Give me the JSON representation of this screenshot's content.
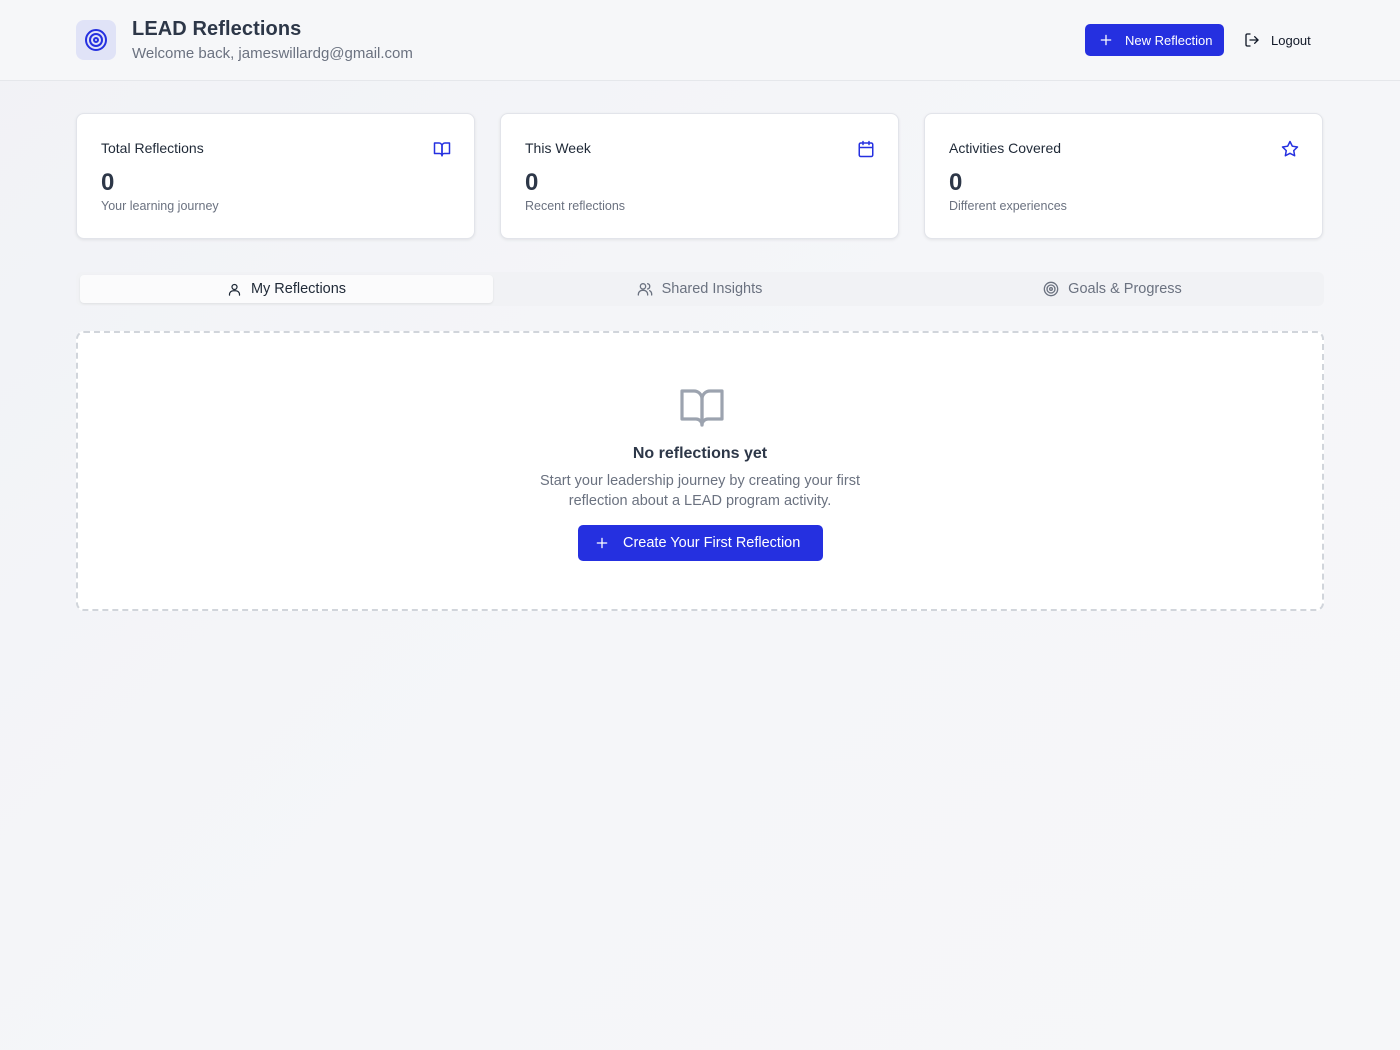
{
  "header": {
    "title": "LEAD Reflections",
    "welcome": "Welcome back, jameswillardg@gmail.com",
    "logo_icon": "target-icon",
    "new_reflection_label": "New Reflection",
    "logout_label": "Logout"
  },
  "stats": [
    {
      "title": "Total Reflections",
      "value": "0",
      "subtitle": "Your learning journey",
      "icon": "book-open-icon"
    },
    {
      "title": "This Week",
      "value": "0",
      "subtitle": "Recent reflections",
      "icon": "calendar-icon"
    },
    {
      "title": "Activities Covered",
      "value": "0",
      "subtitle": "Different experiences",
      "icon": "star-icon"
    }
  ],
  "tabs": [
    {
      "label": "My Reflections",
      "icon": "user-icon",
      "active": true
    },
    {
      "label": "Shared Insights",
      "icon": "users-icon",
      "active": false
    },
    {
      "label": "Goals & Progress",
      "icon": "target-icon",
      "active": false
    }
  ],
  "empty_state": {
    "title": "No reflections yet",
    "description_line1": "Start your leadership journey by creating your first",
    "description_line2": "reflection about a LEAD program activity.",
    "button_label": "Create Your First Reflection"
  },
  "colors": {
    "primary": "#2530e0",
    "background": "#f4f5f8",
    "text_primary": "#2d3748",
    "text_muted": "#6b7280"
  }
}
